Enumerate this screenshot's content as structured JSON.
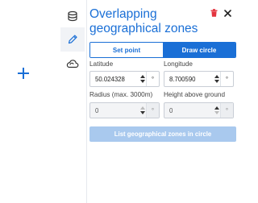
{
  "panel": {
    "title": "Overlapping geographical zones",
    "icons": [
      "trash-icon",
      "close-icon"
    ]
  },
  "toolbar": {
    "items": [
      {
        "name": "layers-icon",
        "active": false
      },
      {
        "name": "pencil-icon",
        "active": true
      },
      {
        "name": "cloud-icon",
        "active": false
      }
    ]
  },
  "mode": {
    "set_point": "Set point",
    "draw_circle": "Draw circle",
    "selected": "draw_circle"
  },
  "fields": {
    "latitude": {
      "label": "Latitude",
      "value": "50.024328",
      "unit": "°"
    },
    "longitude": {
      "label": "Longitude",
      "value": "8.700590",
      "unit": "°"
    },
    "radius": {
      "label": "Radius (max. 3000m)",
      "value": "0",
      "unit": "°"
    },
    "height": {
      "label": "Height above ground",
      "value": "0",
      "unit": "°"
    }
  },
  "list_button": {
    "label": "List geographical zones in circle",
    "enabled": false
  },
  "colors": {
    "accent": "#1a6fd6",
    "delete": "#e3343f",
    "disabled_button": "#a9c9ee"
  }
}
